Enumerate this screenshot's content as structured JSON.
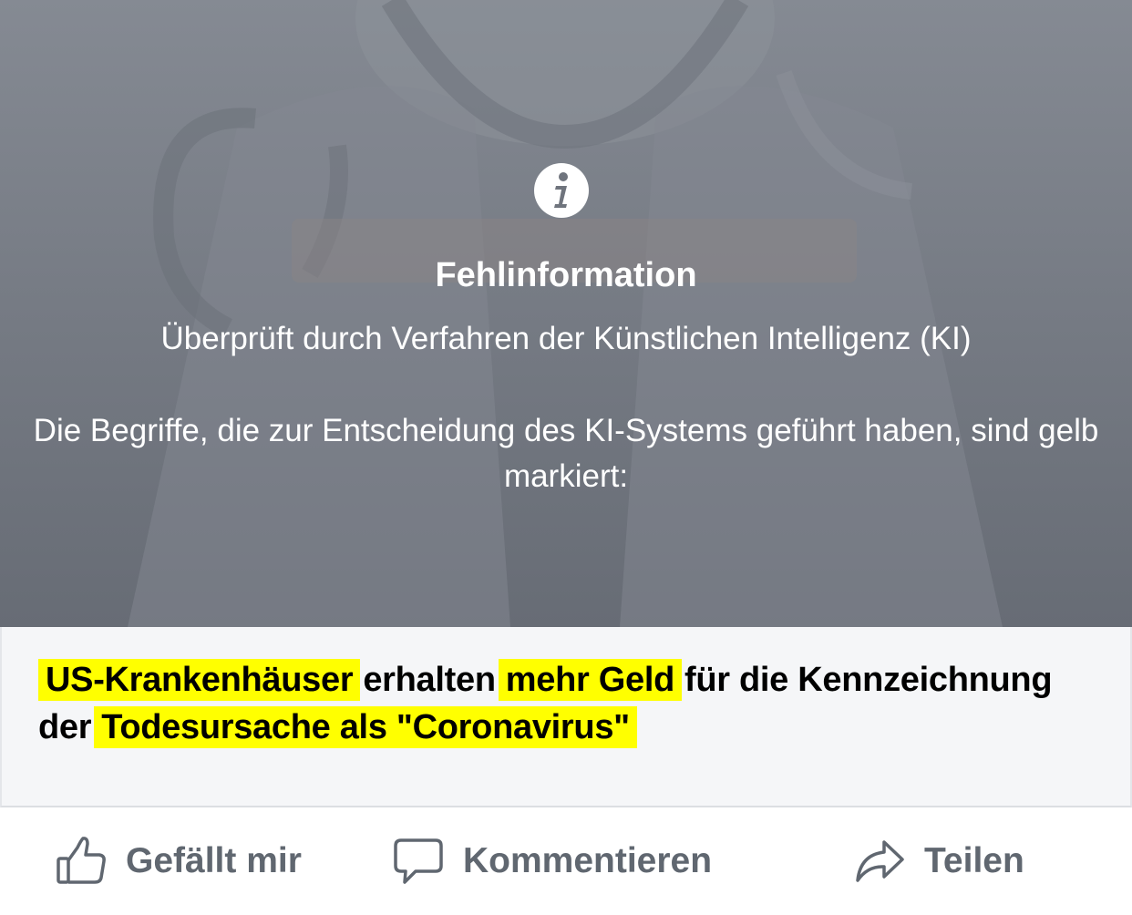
{
  "overlay": {
    "title": "Fehlinformation",
    "subtitle": "Überprüft durch Verfahren der Künstlichen Intelligenz (KI)",
    "explanation": "Die Begriffe, die zur Entscheidung des KI-Systems geführt haben, sind gelb markiert:"
  },
  "headline": {
    "segments": [
      {
        "text": "US-Krankenhäuser",
        "highlighted": true
      },
      {
        "text": "erhalten",
        "highlighted": false
      },
      {
        "text": "mehr Geld",
        "highlighted": true
      },
      {
        "text": "für die Kennzeichnung der",
        "highlighted": false
      },
      {
        "text": "Todesursache als \"Coronavirus\"",
        "highlighted": true
      }
    ],
    "highlight_color": "#ffff00"
  },
  "actions": {
    "like_label": "Gefällt mir",
    "comment_label": "Kommentieren",
    "share_label": "Teilen"
  },
  "icons": {
    "overlay": "info-icon",
    "like": "thumbs-up-icon",
    "comment": "comment-icon",
    "share": "share-arrow-icon"
  },
  "colors": {
    "overlay_bg": "#777c85",
    "overlay_text": "#ffffff",
    "action_text": "#606770",
    "card_bg": "#f5f6f8"
  }
}
